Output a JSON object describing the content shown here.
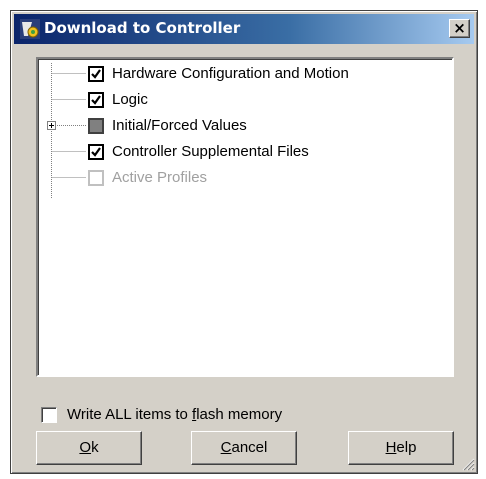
{
  "dialog": {
    "title": "Download to Controller",
    "close_symbol": "×",
    "app_icon": "controller-app-icon"
  },
  "tree": {
    "items": [
      {
        "label": "Hardware Configuration and Motion",
        "state": "checked"
      },
      {
        "label": "Logic",
        "state": "checked"
      },
      {
        "label": "Initial/Forced Values",
        "state": "indeterminate",
        "expandable": true
      },
      {
        "label": "Controller Supplemental Files",
        "state": "checked"
      },
      {
        "label": "Active Profiles",
        "state": "disabled"
      }
    ]
  },
  "flash": {
    "label_before": "Write ALL items to ",
    "label_mnemonic": "f",
    "label_after": "lash memory",
    "checked": false
  },
  "buttons": {
    "ok": {
      "mnemonic": "O",
      "rest": "k"
    },
    "cancel": {
      "mnemonic": "C",
      "rest": "ancel"
    },
    "help": {
      "mnemonic": "H",
      "rest": "elp"
    }
  },
  "colors": {
    "title_start": "#0a246a",
    "title_end": "#a6caf0",
    "face": "#d4d0c8",
    "disabled_text": "#a0a0a0"
  }
}
